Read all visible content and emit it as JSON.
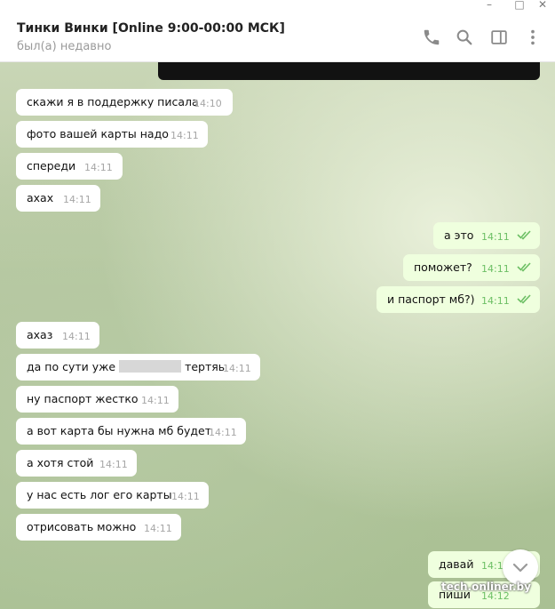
{
  "window_controls": {
    "minimize": "–",
    "maximize": "□",
    "close": "✕"
  },
  "header": {
    "title": "Тинки Винки [Online 9:00-00:00 МСК]",
    "status": "был(а) недавно",
    "icons": [
      "phone-icon",
      "search-icon",
      "sidebar-icon",
      "more-icon"
    ]
  },
  "messages": [
    {
      "dir": "in",
      "text": "скажи я в поддержку писала",
      "time": "14:10"
    },
    {
      "dir": "in",
      "text": "фото вашей карты надо",
      "time": "14:11"
    },
    {
      "dir": "in",
      "text": "спереди",
      "time": "14:11"
    },
    {
      "dir": "in",
      "text": "ахах",
      "time": "14:11"
    },
    {
      "dir": "out",
      "text": "а это",
      "time": "14:11",
      "read": true
    },
    {
      "dir": "out",
      "text": "поможет?",
      "time": "14:11",
      "read": true
    },
    {
      "dir": "out",
      "text": "и паспорт мб?)",
      "time": "14:11",
      "read": true
    },
    {
      "dir": "in",
      "text": "ахаз",
      "time": "14:11"
    },
    {
      "dir": "in",
      "text_before": "да по сути уже",
      "text_after": "тертяь",
      "redacted": true,
      "time": "14:11"
    },
    {
      "dir": "in",
      "text": "ну паспорт жестко",
      "time": "14:11"
    },
    {
      "dir": "in",
      "text": "а вот карта бы нужна мб будет",
      "time": "14:11"
    },
    {
      "dir": "in",
      "text": "а хотя стой",
      "time": "14:11"
    },
    {
      "dir": "in",
      "text": "у нас есть лог его карты",
      "time": "14:11"
    },
    {
      "dir": "in",
      "text": "отрисовать можно",
      "time": "14:11"
    },
    {
      "dir": "out",
      "text": "давай",
      "time": "14:11"
    },
    {
      "dir": "out",
      "text": "пиши",
      "time": "14:12"
    }
  ],
  "watermark": "tech.onliner.by",
  "colors": {
    "incoming_bubble": "#ffffff",
    "outgoing_bubble": "#efffde",
    "read_ticks": "#6cbf64",
    "time": "#a6a6a6"
  }
}
